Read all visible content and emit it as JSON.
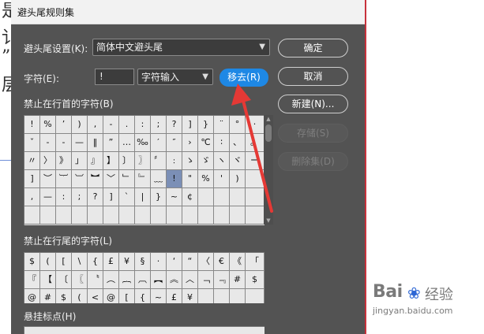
{
  "background": {
    "doc_chars": [
      "是",
      "讠",
      "”",
      "层"
    ]
  },
  "dialog": {
    "title": "避头尾规则集",
    "setting_label": "避头尾设置(K):",
    "setting_value": "简体中文避头尾",
    "char_label": "字符(E):",
    "char_value": "!",
    "input_mode": "字符输入",
    "buttons": {
      "ok": "确定",
      "cancel": "取消",
      "new": "新建(N)...",
      "remove": "移去(R)",
      "save": "存储(S)",
      "delete_set": "删除集(D)"
    },
    "sections": {
      "not_begin": "禁止在行首的字符(B)",
      "not_end": "禁止在行尾的字符(L)",
      "hanging": "悬挂标点(H)"
    },
    "not_begin_rows": [
      [
        "!",
        "%",
        "’",
        ")",
        ",",
        "-",
        ".",
        ":",
        ";",
        "?",
        "]",
        "}",
        "¨",
        "°",
        "·"
      ],
      [
        "ˇ",
        "-",
        "-",
        "—",
        "‖",
        "”",
        "…",
        "‰",
        "′",
        "″",
        "›",
        "℃",
        "∶",
        "、",
        "。"
      ],
      [
        "〃",
        "〉",
        "》",
        "」",
        "』",
        "】",
        "〕",
        "〗",
        "〞",
        "﹕",
        "ゝ",
        "ゞ",
        "ヽ",
        "ヾ",
        "ー"
      ],
      [
        "]",
        "︶",
        "︸",
        "︺",
        "︼",
        "﹀",
        "﹂",
        "﹄",
        "﹏",
        "!",
        "\"",
        "%",
        "'",
        ")",
        ""
      ],
      [
        ",",
        "—",
        ":",
        ";",
        "?",
        "]",
        "`",
        "|",
        "}",
        "~",
        "¢",
        "",
        "",
        "",
        ""
      ],
      [
        "",
        "",
        "",
        "",
        "",
        "",
        "",
        "",
        "",
        "",
        "",
        "",
        "",
        "",
        ""
      ]
    ],
    "not_end_rows": [
      [
        "$",
        "(",
        "[",
        "\\",
        "{",
        "£",
        "¥",
        "§",
        "·",
        "‘",
        "“",
        "〈",
        "€",
        "《",
        "「"
      ],
      [
        "『",
        "【",
        "〔",
        "〖",
        "〝",
        "︵",
        "︷",
        "︹",
        "︻",
        "︽",
        "︿",
        "﹁",
        "﹃",
        "#",
        "$"
      ],
      [
        "@",
        "#",
        "$",
        "(",
        "<",
        "@",
        "[",
        "{",
        "~",
        "£",
        "¥",
        "",
        "",
        "",
        ""
      ]
    ]
  },
  "watermark": {
    "logo": "Bai",
    "logo_cn": "经验",
    "url": "jingyan.baidu.com"
  },
  "colors": {
    "accent": "#1e88e5",
    "annotation": "#e53935",
    "dialog_bg": "#535353"
  }
}
